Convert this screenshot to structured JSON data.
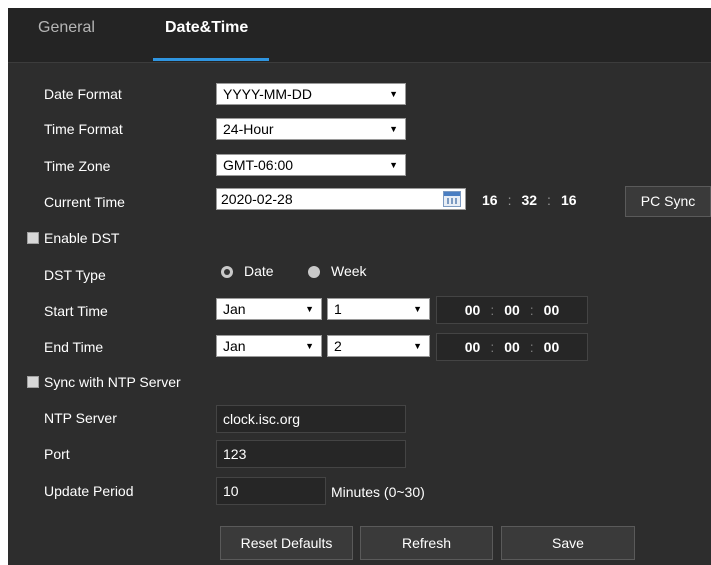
{
  "tabs": [
    {
      "label": "General",
      "active": false
    },
    {
      "label": "Date&Time",
      "active": true
    }
  ],
  "accent_color": "#2f95e0",
  "date_format": {
    "label": "Date Format",
    "value": "YYYY-MM-DD"
  },
  "time_format": {
    "label": "Time Format",
    "value": "24-Hour"
  },
  "time_zone": {
    "label": "Time Zone",
    "value": "GMT-06:00"
  },
  "current_time": {
    "label": "Current Time",
    "date": "2020-02-28",
    "hh": "16",
    "mm": "32",
    "ss": "16",
    "sep": ":",
    "pc_sync_label": "PC Sync"
  },
  "enable_dst": {
    "label": "Enable DST",
    "checked": false
  },
  "dst_type": {
    "label": "DST Type",
    "options": [
      {
        "label": "Date",
        "selected": true
      },
      {
        "label": "Week",
        "selected": false
      }
    ]
  },
  "start_time": {
    "label": "Start Time",
    "month": "Jan",
    "day": "1",
    "hh": "00",
    "mm": "00",
    "ss": "00"
  },
  "end_time": {
    "label": "End Time",
    "month": "Jan",
    "day": "2",
    "hh": "00",
    "mm": "00",
    "ss": "00"
  },
  "sync_ntp": {
    "label": "Sync with NTP Server",
    "checked": false
  },
  "ntp_server": {
    "label": "NTP Server",
    "value": "clock.isc.org"
  },
  "port": {
    "label": "Port",
    "value": "123"
  },
  "update_period": {
    "label": "Update Period",
    "value": "10",
    "unit": "Minutes (0~30)"
  },
  "buttons": {
    "reset": "Reset Defaults",
    "refresh": "Refresh",
    "save": "Save"
  },
  "icons": {
    "dropdown": "dropdown-arrow-icon",
    "calendar": "calendar-icon"
  }
}
